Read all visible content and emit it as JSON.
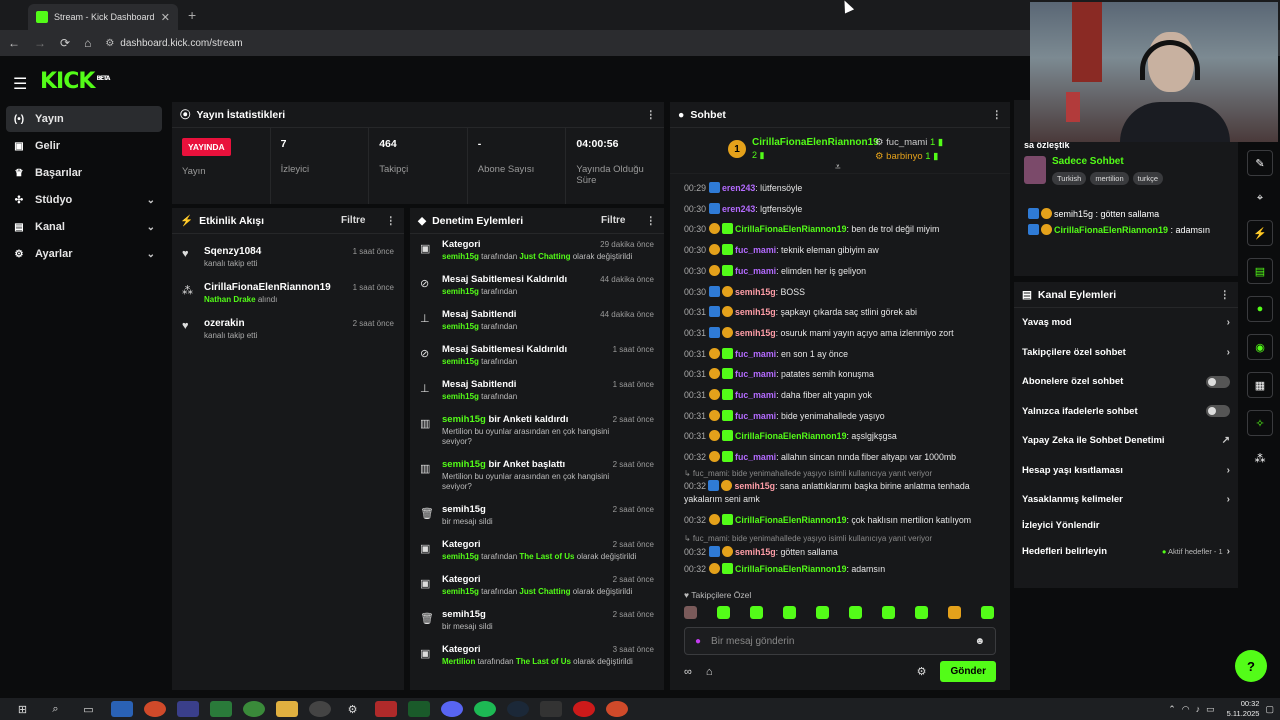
{
  "browser": {
    "tab_title": "Stream - Kick Dashboard",
    "url": "dashboard.kick.com/stream"
  },
  "brand": {
    "logo": "KICK",
    "beta": "BETA"
  },
  "sidebar": {
    "items": [
      {
        "label": "Yayın",
        "icon": "broadcast-icon",
        "active": true
      },
      {
        "label": "Gelir",
        "icon": "wallet-icon"
      },
      {
        "label": "Başarılar",
        "icon": "trophy-icon"
      },
      {
        "label": "Stüdyo",
        "icon": "studio-icon",
        "expandable": true
      },
      {
        "label": "Kanal",
        "icon": "channel-icon",
        "expandable": true
      },
      {
        "label": "Ayarlar",
        "icon": "gear-icon",
        "expandable": true
      }
    ]
  },
  "stats": {
    "title": "Yayın İstatistikleri",
    "live_badge": "YAYINDA",
    "live_label": "Yayın",
    "viewers": {
      "value": "7",
      "label": "İzleyici"
    },
    "followers": {
      "value": "464",
      "label": "Takipçi"
    },
    "subscribers": {
      "value": "-",
      "label": "Abone Sayısı"
    },
    "uptime": {
      "value": "04:00:56",
      "label": "Yayında Olduğu Süre"
    }
  },
  "activity": {
    "title": "Etkinlik Akışı",
    "filter": "Filtre",
    "items": [
      {
        "name": "Sqenzy1084",
        "sub": "kanalı takip etti",
        "time": "1 saat önce",
        "icon": "heart-icon"
      },
      {
        "name": "CirillaFionaElenRiannon19",
        "sub_green": "Nathan Drake",
        "sub": "alındı",
        "time": "1 saat önce",
        "icon": "gift-icon"
      },
      {
        "name": "ozerakin",
        "sub": "kanalı takip etti",
        "time": "2 saat önce",
        "icon": "heart-icon"
      }
    ]
  },
  "moderation": {
    "title": "Denetim Eylemleri",
    "filter": "Filtre",
    "items": [
      {
        "title": "Kategori",
        "time": "29 dakika önce",
        "user": "semih15g",
        "t1": " tarafından ",
        "g2": "Just Chatting",
        "t2": " olarak değiştirildi",
        "icon": "category-icon"
      },
      {
        "title": "Mesaj Sabitlemesi Kaldırıldı",
        "time": "44 dakika önce",
        "user": "semih15g",
        "t1": " tarafından",
        "g2": "",
        "t2": "",
        "icon": "unpin-icon"
      },
      {
        "title": "Mesaj Sabitlendi",
        "time": "44 dakika önce",
        "user": "semih15g",
        "t1": " tarafından",
        "g2": "",
        "t2": "",
        "icon": "pin-icon"
      },
      {
        "title": "Mesaj Sabitlemesi Kaldırıldı",
        "time": "1 saat önce",
        "user": "semih15g",
        "t1": " tarafından",
        "g2": "",
        "t2": "",
        "icon": "unpin-icon"
      },
      {
        "title": "Mesaj Sabitlendi",
        "time": "1 saat önce",
        "user": "semih15g",
        "t1": " tarafından",
        "g2": "",
        "t2": "",
        "icon": "pin-icon"
      },
      {
        "title_user": "semih15g",
        "title": " bir Anketi kaldırdı",
        "time": "2 saat önce",
        "plain": "Mertilion bu oyunlar arasından en çok hangisini seviyor?",
        "icon": "poll-icon"
      },
      {
        "title_user": "semih15g",
        "title": " bir Anket başlattı",
        "time": "2 saat önce",
        "plain": "Mertilion bu oyunlar arasından en çok hangisini seviyor?",
        "icon": "poll-icon"
      },
      {
        "title": "semih15g",
        "time": "2 saat önce",
        "plain": "bir mesajı sildi",
        "icon": "trash-icon"
      },
      {
        "title": "Kategori",
        "time": "2 saat önce",
        "user": "semih15g",
        "t1": " tarafından ",
        "g2": "The Last of Us",
        "t2": " olarak değiştirildi",
        "icon": "category-icon"
      },
      {
        "title": "Kategori",
        "time": "2 saat önce",
        "user": "semih15g",
        "t1": " tarafından ",
        "g2": "Just Chatting",
        "t2": " olarak değiştirildi",
        "icon": "category-icon"
      },
      {
        "title": "semih15g",
        "time": "2 saat önce",
        "plain": "bir mesajı sildi",
        "icon": "trash-icon"
      },
      {
        "title": "Kategori",
        "time": "3 saat önce",
        "user": "Mertilion",
        "t1": " tarafından ",
        "g2": "The Last of Us",
        "t2": " olarak değiştirildi",
        "icon": "category-icon"
      }
    ]
  },
  "chat": {
    "title": "Sohbet",
    "pinned": {
      "top_user": "CirillaFionaElenRiannon19",
      "top_count": "2",
      "rank1": "1",
      "second_user": "fuc_mami",
      "second_count": "1",
      "third_user": "barbinyo",
      "third_count": "1"
    },
    "messages": [
      {
        "time": "00:29",
        "user": "eren243",
        "color": "#b46bff",
        "badges": [
          "b"
        ],
        "text": ": lütfensöyle"
      },
      {
        "time": "00:30",
        "user": "eren243",
        "color": "#b46bff",
        "badges": [
          "b"
        ],
        "text": ": lgtfensöyle"
      },
      {
        "time": "00:30",
        "user": "CirillaFionaElenRiannon19",
        "color": "#53fc18",
        "badges": [
          "o",
          "g"
        ],
        "text": ": ben de trol değil miyim"
      },
      {
        "time": "00:30",
        "user": "fuc_mami",
        "color": "#b46bff",
        "badges": [
          "o",
          "g"
        ],
        "text": ": teknik eleman gibiyim aw"
      },
      {
        "time": "00:30",
        "user": "fuc_mami",
        "color": "#b46bff",
        "badges": [
          "o",
          "g"
        ],
        "text": ": elimden her iş geliyon"
      },
      {
        "time": "00:30",
        "user": "semih15g",
        "color": "#ff9ea8",
        "badges": [
          "b",
          "o"
        ],
        "text": ": BOSS"
      },
      {
        "time": "00:31",
        "user": "semih15g",
        "color": "#ff9ea8",
        "badges": [
          "b",
          "o"
        ],
        "text": ": şapkayı çıkarda saç stlini görek abi"
      },
      {
        "time": "00:31",
        "user": "semih15g",
        "color": "#ff9ea8",
        "badges": [
          "b",
          "o"
        ],
        "text": ": osuruk mami yayın açıyo ama izlenmiyo zort"
      },
      {
        "time": "00:31",
        "user": "fuc_mami",
        "color": "#b46bff",
        "badges": [
          "o",
          "g"
        ],
        "text": ": en son 1 ay önce"
      },
      {
        "time": "00:31",
        "user": "fuc_mami",
        "color": "#b46bff",
        "badges": [
          "o",
          "g"
        ],
        "text": ": patates semih konuşma"
      },
      {
        "time": "00:31",
        "user": "fuc_mami",
        "color": "#b46bff",
        "badges": [
          "o",
          "g"
        ],
        "text": ": daha fiber alt yapın yok"
      },
      {
        "time": "00:31",
        "user": "fuc_mami",
        "color": "#b46bff",
        "badges": [
          "o",
          "g"
        ],
        "text": ": bide yenimahallede yaşıyo"
      },
      {
        "time": "00:31",
        "user": "CirillaFionaElenRiannon19",
        "color": "#53fc18",
        "badges": [
          "o",
          "g"
        ],
        "text": ": aşslgjkşgsa"
      },
      {
        "time": "00:32",
        "user": "fuc_mami",
        "color": "#b46bff",
        "badges": [
          "o",
          "g"
        ],
        "text": ": allahın sincan nında fiber altyapı var 1000mb"
      }
    ],
    "reply1": "↳ fuc_mami: bide yenimahallede yaşıyo isimli kullanıcıya yanıt veriyor",
    "long_msg": {
      "time": "00:32",
      "user": "semih15g",
      "text": ": sana anlattıklarımı başka birine anlatma tenhada yakalarım seni amk"
    },
    "msg_after": {
      "time": "00:32",
      "user": "CirillaFionaElenRiannon19",
      "text": ": çok haklısın mertilion katılıyom"
    },
    "reply2": "↳ fuc_mami: bide yenimahallede yaşıyo isimli kullanıcıya yanıt veriyor",
    "msg_reply2": {
      "time": "00:32",
      "user": "semih15g",
      "text": ": götten sallama"
    },
    "msg_last": {
      "time": "00:32",
      "user": "CirillaFionaElenRiannon19",
      "text": ": adamsın"
    },
    "followers_only": "♥ Takipçilere Özel",
    "input_placeholder": "Bir mesaj gönderin",
    "send": "Gönder"
  },
  "stream_info": {
    "title_partial": "sa özleştik",
    "title": "Sadece Sohbet",
    "tags": [
      "Turkish",
      "mertilion",
      "turkçe"
    ],
    "mini_chat": [
      {
        "user": "semih15g",
        "text": " : götten sallama"
      },
      {
        "user": "CirillaFionaElenRiannon19",
        "text": " : adamsın"
      }
    ]
  },
  "channel_actions": {
    "title": "Kanal Eylemleri",
    "rows": [
      {
        "label": "Yavaş mod",
        "kind": "arrow"
      },
      {
        "label": "Takipçilere özel sohbet",
        "kind": "arrow"
      },
      {
        "label": "Abonelere özel sohbet",
        "kind": "toggle"
      },
      {
        "label": "Yalnızca ifadelerle sohbet",
        "kind": "toggle"
      },
      {
        "label": "Yapay Zeka ile Sohbet Denetimi",
        "kind": "ext"
      },
      {
        "label": "Hesap yaşı kısıtlaması",
        "kind": "arrow"
      },
      {
        "label": "Yasaklanmış kelimeler",
        "kind": "arrow"
      },
      {
        "label": "İzleyici Yönlendir",
        "kind": "none"
      },
      {
        "label": "Hedefleri belirleyin",
        "kind": "arrow",
        "aside": "Aktif hedefler - 1"
      }
    ]
  },
  "taskbar": {
    "clock_time": "00:32",
    "clock_date": "5.11.2025"
  }
}
